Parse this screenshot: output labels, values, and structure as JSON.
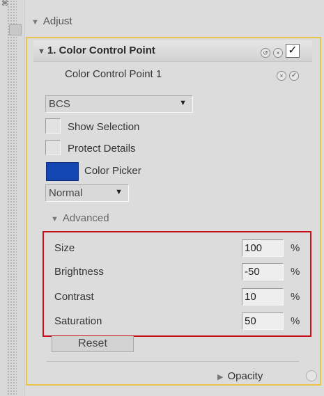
{
  "adjust": {
    "title": "Adjust"
  },
  "ccp": {
    "title": "1. Color Control Point",
    "point_label": "Color Control Point 1",
    "mode_select": "BCS",
    "show_selection": "Show Selection",
    "protect_details": "Protect Details",
    "color_picker": "Color Picker",
    "color": "#1446b4",
    "blend_select": "Normal",
    "advanced": "Advanced",
    "sliders": [
      {
        "label": "Size",
        "value": "100",
        "unit": "%"
      },
      {
        "label": "Brightness",
        "value": "-50",
        "unit": "%"
      },
      {
        "label": "Contrast",
        "value": "10",
        "unit": "%"
      },
      {
        "label": "Saturation",
        "value": "50",
        "unit": "%"
      }
    ],
    "reset": "Reset",
    "opacity": "Opacity",
    "enabled_check": "✓",
    "point_check": "✓"
  },
  "icons": {
    "collapse": "triangle-down-icon",
    "expand": "triangle-right-icon",
    "undo": "undo-icon",
    "close": "close-icon"
  },
  "colors": {
    "panel_border": "#e7c44a",
    "highlight_border": "#c8101d"
  }
}
